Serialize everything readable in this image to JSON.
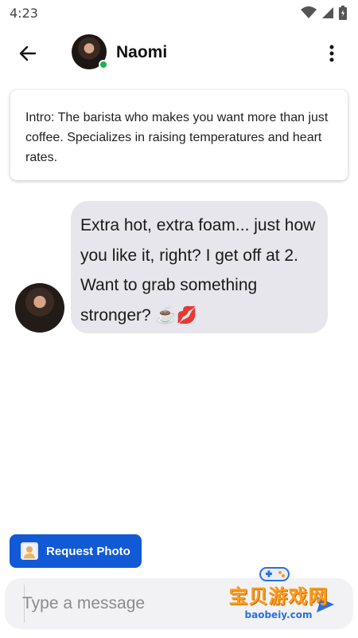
{
  "status_bar": {
    "time": "4:23"
  },
  "header": {
    "name": "Naomi",
    "online_color": "#1db24a"
  },
  "intro": {
    "text": "Intro: The barista who makes you want more than just coffee. Specializes in raising temperatures and heart rates."
  },
  "messages": [
    {
      "text": "Extra hot, extra foam... just how you like it, right? I get off at 2. Want to grab something stronger? ☕💋"
    }
  ],
  "actions": {
    "request_photo_label": "Request Photo"
  },
  "composer": {
    "placeholder": "Type a message"
  },
  "watermark": {
    "title": "宝贝游戏网",
    "url": "baobeiy.com"
  },
  "colors": {
    "accent": "#1259d6",
    "bubble_bg": "#e6e6ec"
  },
  "icons": {
    "back": "arrow-left-icon",
    "menu": "more-vertical-icon",
    "wifi": "wifi-icon",
    "signal": "signal-icon",
    "battery": "battery-icon",
    "request_photo": "person-photo-icon",
    "send": "send-icon"
  }
}
